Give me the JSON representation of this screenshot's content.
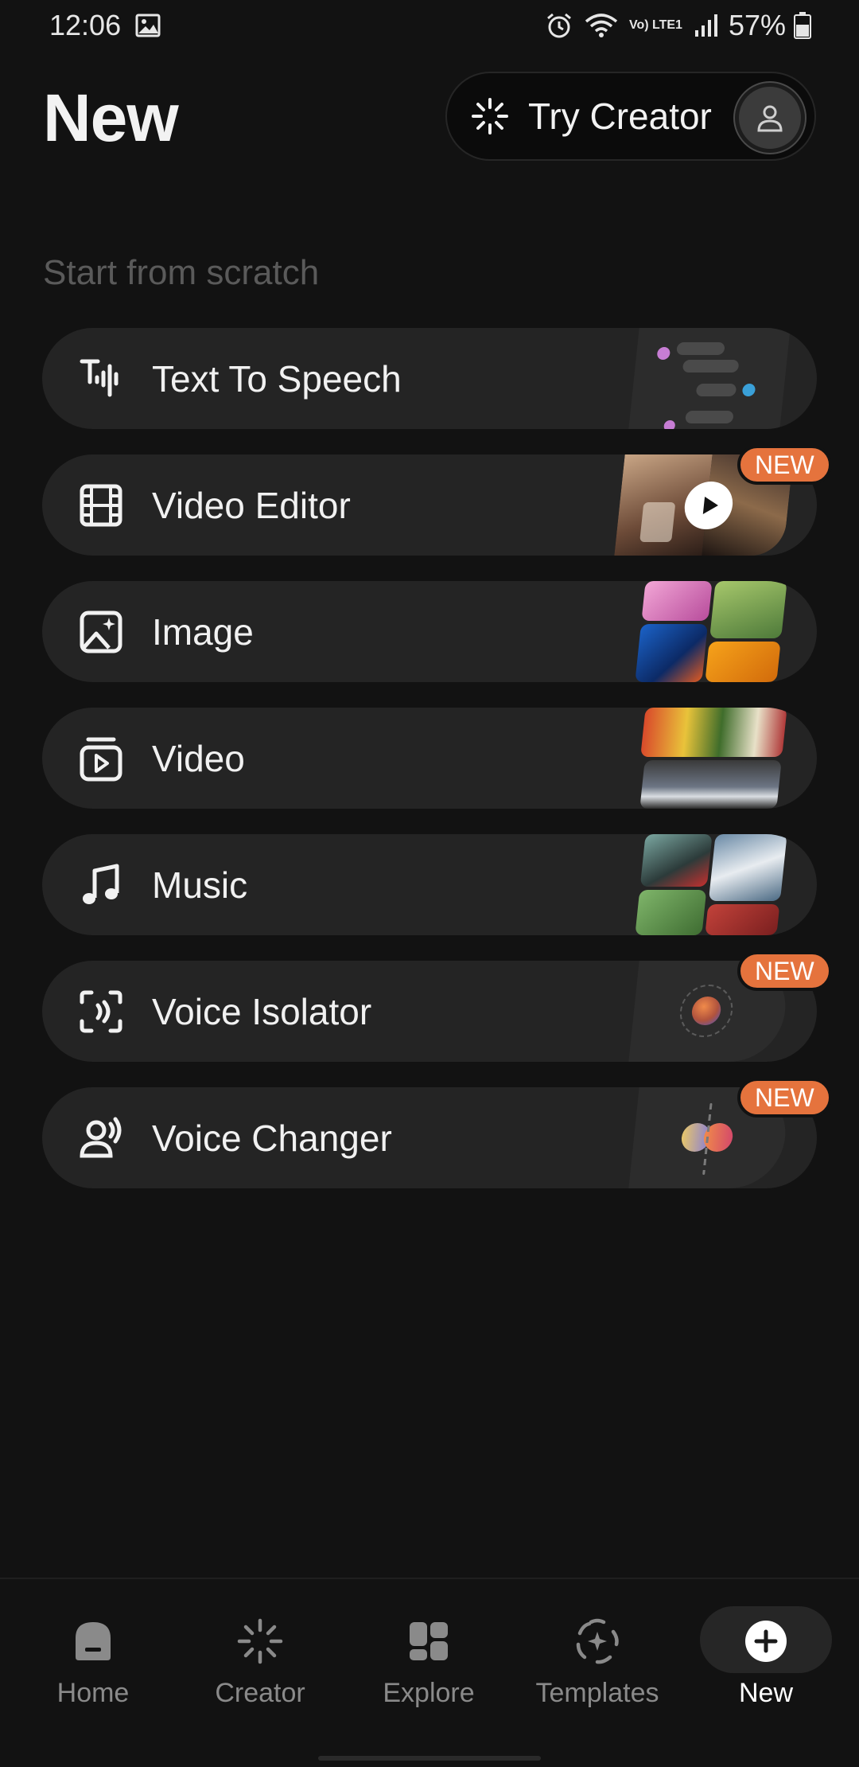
{
  "status_bar": {
    "time": "12:06",
    "battery_percent": "57%",
    "network_label": "Vo) LTE1",
    "icons": [
      "gallery-icon",
      "alarm-icon",
      "wifi-icon",
      "volte-icon",
      "signal-icon",
      "battery-icon"
    ]
  },
  "header": {
    "title": "New",
    "try_creator_label": "Try Creator"
  },
  "section": {
    "label": "Start from scratch"
  },
  "items": [
    {
      "label": "Text To Speech",
      "icon": "text-to-speech-icon",
      "badge": ""
    },
    {
      "label": "Video Editor",
      "icon": "film-icon",
      "badge": "NEW"
    },
    {
      "label": "Image",
      "icon": "image-icon",
      "badge": ""
    },
    {
      "label": "Video",
      "icon": "video-icon",
      "badge": ""
    },
    {
      "label": "Music",
      "icon": "music-note-icon",
      "badge": ""
    },
    {
      "label": "Voice Isolator",
      "icon": "voice-isolator-icon",
      "badge": "NEW"
    },
    {
      "label": "Voice Changer",
      "icon": "voice-changer-icon",
      "badge": "NEW"
    }
  ],
  "nav": {
    "items": [
      {
        "label": "Home",
        "icon": "home-icon"
      },
      {
        "label": "Creator",
        "icon": "spark-icon"
      },
      {
        "label": "Explore",
        "icon": "explore-grid-icon"
      },
      {
        "label": "Templates",
        "icon": "templates-icon"
      },
      {
        "label": "New",
        "icon": "plus-icon"
      }
    ],
    "active": "New"
  },
  "colors": {
    "background": "#121212",
    "row": "#242424",
    "badge": "#e5733d",
    "muted_text": "#5a5a5a"
  }
}
